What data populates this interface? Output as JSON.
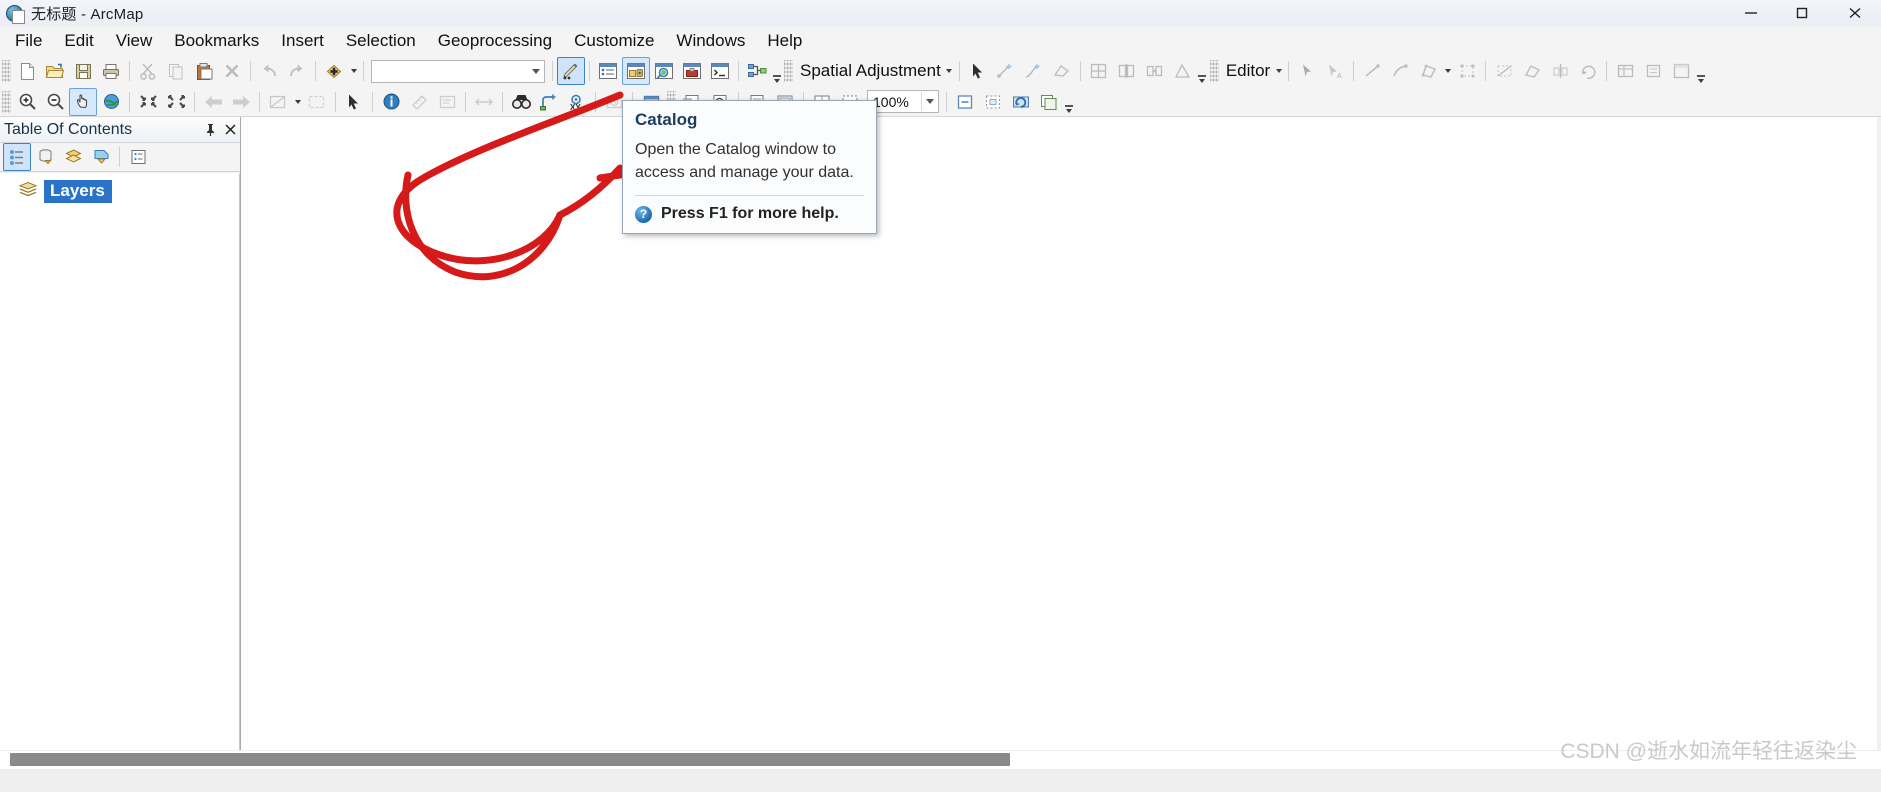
{
  "window": {
    "title": "无标题 - ArcMap",
    "app_icon": "arcmap-globe-icon",
    "controls": {
      "minimize": "minimize-icon",
      "maximize": "maximize-icon",
      "close": "close-icon"
    }
  },
  "menubar": {
    "items": [
      {
        "label": "File"
      },
      {
        "label": "Edit"
      },
      {
        "label": "View"
      },
      {
        "label": "Bookmarks"
      },
      {
        "label": "Insert"
      },
      {
        "label": "Selection"
      },
      {
        "label": "Geoprocessing"
      },
      {
        "label": "Customize"
      },
      {
        "label": "Windows"
      },
      {
        "label": "Help"
      }
    ]
  },
  "standard_toolbar": {
    "buttons": [
      {
        "name": "new-map-icon",
        "state": "normal"
      },
      {
        "name": "open-document-icon",
        "state": "normal"
      },
      {
        "name": "save-icon",
        "state": "normal"
      },
      {
        "name": "print-icon",
        "state": "normal"
      },
      {
        "name": "cut-icon",
        "state": "disabled"
      },
      {
        "name": "copy-icon",
        "state": "disabled"
      },
      {
        "name": "paste-icon",
        "state": "normal"
      },
      {
        "name": "delete-icon",
        "state": "disabled"
      },
      {
        "name": "undo-icon",
        "state": "disabled"
      },
      {
        "name": "redo-icon",
        "state": "disabled"
      },
      {
        "name": "add-data-icon",
        "state": "normal"
      }
    ],
    "scale_combo": {
      "value": "",
      "placeholder": ""
    },
    "right_buttons": [
      {
        "name": "editor-toolbar-icon",
        "state": "selected"
      },
      {
        "name": "table-of-contents-icon",
        "state": "normal"
      },
      {
        "name": "catalog-icon",
        "state": "active"
      },
      {
        "name": "search-window-icon",
        "state": "normal"
      },
      {
        "name": "arctoolbox-icon",
        "state": "normal"
      },
      {
        "name": "python-window-icon",
        "state": "normal"
      },
      {
        "name": "model-builder-icon",
        "state": "normal"
      }
    ]
  },
  "spatial_adjustment_toolbar": {
    "menu_label": "Spatial Adjustment",
    "buttons": [
      {
        "name": "select-elements-icon",
        "state": "normal"
      },
      {
        "name": "new-displacement-link-icon",
        "state": "disabled"
      },
      {
        "name": "new-identity-link-icon",
        "state": "disabled"
      },
      {
        "name": "new-multipoint-link-icon",
        "state": "disabled"
      },
      {
        "name": "view-link-table-icon",
        "state": "disabled"
      },
      {
        "name": "edge-match-icon",
        "state": "disabled"
      },
      {
        "name": "attribute-transfer-icon",
        "state": "disabled"
      },
      {
        "name": "adjust-icon",
        "state": "disabled"
      }
    ]
  },
  "editor_toolbar": {
    "menu_label": "Editor",
    "buttons": [
      {
        "name": "edit-tool-icon",
        "state": "disabled"
      },
      {
        "name": "edit-annotation-tool-icon",
        "state": "disabled"
      },
      {
        "name": "straight-segment-icon",
        "state": "disabled"
      },
      {
        "name": "end-point-arc-segment-icon",
        "state": "disabled"
      },
      {
        "name": "create-features-icon",
        "state": "disabled"
      },
      {
        "name": "edit-vertices-icon",
        "state": "disabled"
      },
      {
        "name": "reshape-feature-icon",
        "state": "disabled"
      },
      {
        "name": "cut-polygons-icon",
        "state": "disabled"
      },
      {
        "name": "split-tool-icon",
        "state": "disabled"
      },
      {
        "name": "rotate-tool-icon",
        "state": "disabled"
      },
      {
        "name": "attributes-icon",
        "state": "disabled"
      },
      {
        "name": "sketch-properties-icon",
        "state": "disabled"
      },
      {
        "name": "create-features-window-icon",
        "state": "disabled"
      }
    ]
  },
  "tools_toolbar": {
    "buttons": [
      {
        "name": "zoom-in-icon",
        "state": "normal"
      },
      {
        "name": "zoom-out-icon",
        "state": "normal"
      },
      {
        "name": "pan-icon",
        "state": "active"
      },
      {
        "name": "full-extent-icon",
        "state": "normal"
      },
      {
        "name": "fixed-zoom-in-icon",
        "state": "normal"
      },
      {
        "name": "fixed-zoom-out-icon",
        "state": "normal"
      },
      {
        "name": "go-back-extent-icon",
        "state": "disabled"
      },
      {
        "name": "go-forward-extent-icon",
        "state": "disabled"
      },
      {
        "name": "select-features-icon",
        "state": "disabled"
      },
      {
        "name": "clear-selection-icon",
        "state": "disabled"
      },
      {
        "name": "select-elements-icon",
        "state": "normal"
      },
      {
        "name": "identify-icon",
        "state": "normal"
      },
      {
        "name": "measure-icon",
        "state": "disabled"
      },
      {
        "name": "html-popup-icon",
        "state": "disabled"
      },
      {
        "name": "time-slider-icon",
        "state": "disabled"
      },
      {
        "name": "find-icon",
        "state": "normal"
      },
      {
        "name": "find-route-icon",
        "state": "normal"
      },
      {
        "name": "go-to-xy-icon",
        "state": "normal"
      },
      {
        "name": "time-slider-window-icon",
        "state": "disabled"
      },
      {
        "name": "create-viewer-window-icon",
        "state": "normal"
      }
    ]
  },
  "layout_toolbar": {
    "zoom": {
      "value": "100%",
      "label": "zoom-percent"
    },
    "buttons": [
      {
        "name": "zoom-whole-page-icon",
        "state": "normal"
      },
      {
        "name": "zoom-to-percent-icon",
        "state": "normal"
      },
      {
        "name": "page-layout-icon",
        "state": "normal"
      },
      {
        "name": "data-frame-icon",
        "state": "normal"
      },
      {
        "name": "change-layout-icon",
        "state": "normal"
      },
      {
        "name": "focus-data-frame-icon",
        "state": "normal"
      },
      {
        "name": "refresh-view-icon",
        "state": "normal"
      },
      {
        "name": "toggle-draft-mode-icon",
        "state": "normal"
      }
    ]
  },
  "table_of_contents": {
    "title": "Table Of Contents",
    "pin_icon": "pin-icon",
    "close_icon": "close-icon",
    "list_by_buttons": [
      {
        "name": "list-by-drawing-order-icon",
        "state": "selected"
      },
      {
        "name": "list-by-source-icon",
        "state": "normal"
      },
      {
        "name": "list-by-visibility-icon",
        "state": "normal"
      },
      {
        "name": "list-by-selection-icon",
        "state": "normal"
      },
      {
        "name": "options-icon",
        "state": "normal"
      }
    ],
    "tree": [
      {
        "label": "Layers",
        "icon": "layers-icon",
        "selected": true
      }
    ]
  },
  "tooltip": {
    "title": "Catalog",
    "body": "Open the Catalog window to access and manage your data.",
    "help_icon": "help-question-icon",
    "help_text": "Press F1 for more help."
  },
  "annotation": {
    "color": "#d61919",
    "description": "hand-drawn-red-arrow-pointing-to-catalog-button"
  },
  "watermark": {
    "text": "CSDN @逝水如流年轻往返染尘"
  },
  "colors": {
    "accent": "#2a73c8",
    "toolbar_bg": "#f4f4f4",
    "titlebar_bg": "#eef1f7",
    "annotation_red": "#d61919",
    "selection_blue": "#cfe4fa"
  }
}
